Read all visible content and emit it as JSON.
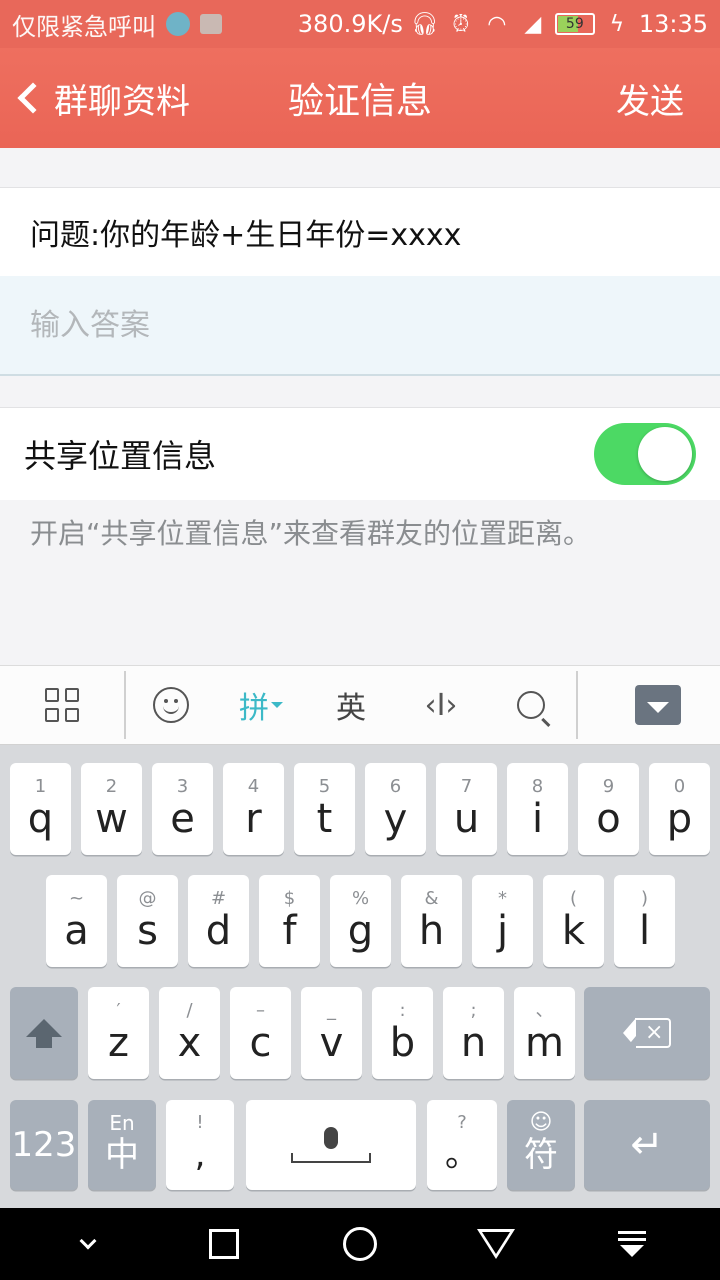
{
  "status_bar": {
    "notice": "仅限紧急呼叫",
    "speed": "380.9K/s",
    "battery_level": "59",
    "time": "13:35",
    "icons": [
      "timer-icon",
      "image-icon",
      "headphones-icon",
      "alarm-icon",
      "wifi-icon",
      "no-signal-icon",
      "battery-icon",
      "charging-icon"
    ]
  },
  "nav": {
    "back_label": "群聊资料",
    "title": "验证信息",
    "send_label": "发送"
  },
  "form": {
    "question": "问题:你的年龄+生日年份=xxxx",
    "answer_value": "",
    "answer_placeholder": "输入答案",
    "share_label": "共享位置信息",
    "share_on": true,
    "share_description": "开启“共享位置信息”来查看群友的位置距离。"
  },
  "colors": {
    "header": "#ea6556",
    "toggle_on": "#4cd964",
    "pinyin_accent": "#3cb9c7"
  },
  "keyboard_toolbar": {
    "pinyin_label": "拼",
    "english_label": "英"
  },
  "keyboard": {
    "row1": [
      {
        "sub": "1",
        "main": "q"
      },
      {
        "sub": "2",
        "main": "w"
      },
      {
        "sub": "3",
        "main": "e"
      },
      {
        "sub": "4",
        "main": "r"
      },
      {
        "sub": "5",
        "main": "t"
      },
      {
        "sub": "6",
        "main": "y"
      },
      {
        "sub": "7",
        "main": "u"
      },
      {
        "sub": "8",
        "main": "i"
      },
      {
        "sub": "9",
        "main": "o"
      },
      {
        "sub": "0",
        "main": "p"
      }
    ],
    "row2": [
      {
        "sub": "~",
        "main": "a"
      },
      {
        "sub": "@",
        "main": "s"
      },
      {
        "sub": "#",
        "main": "d"
      },
      {
        "sub": "$",
        "main": "f"
      },
      {
        "sub": "%",
        "main": "g"
      },
      {
        "sub": "&",
        "main": "h"
      },
      {
        "sub": "*",
        "main": "j"
      },
      {
        "sub": "(",
        "main": "k"
      },
      {
        "sub": ")",
        "main": "l"
      }
    ],
    "row3": [
      {
        "sub": "′",
        "main": "z"
      },
      {
        "sub": "/",
        "main": "x"
      },
      {
        "sub": "–",
        "main": "c"
      },
      {
        "sub": "_",
        "main": "v"
      },
      {
        "sub": ":",
        "main": "b"
      },
      {
        "sub": ";",
        "main": "n"
      },
      {
        "sub": "、",
        "main": "m"
      }
    ],
    "num_label": "123",
    "lang_sub": "En",
    "lang_main": "中",
    "punct_sub": "!",
    "punct_main": ",",
    "period_sub": "?",
    "period_main": "。",
    "symbol_sub": "☺",
    "symbol_main": "符"
  }
}
